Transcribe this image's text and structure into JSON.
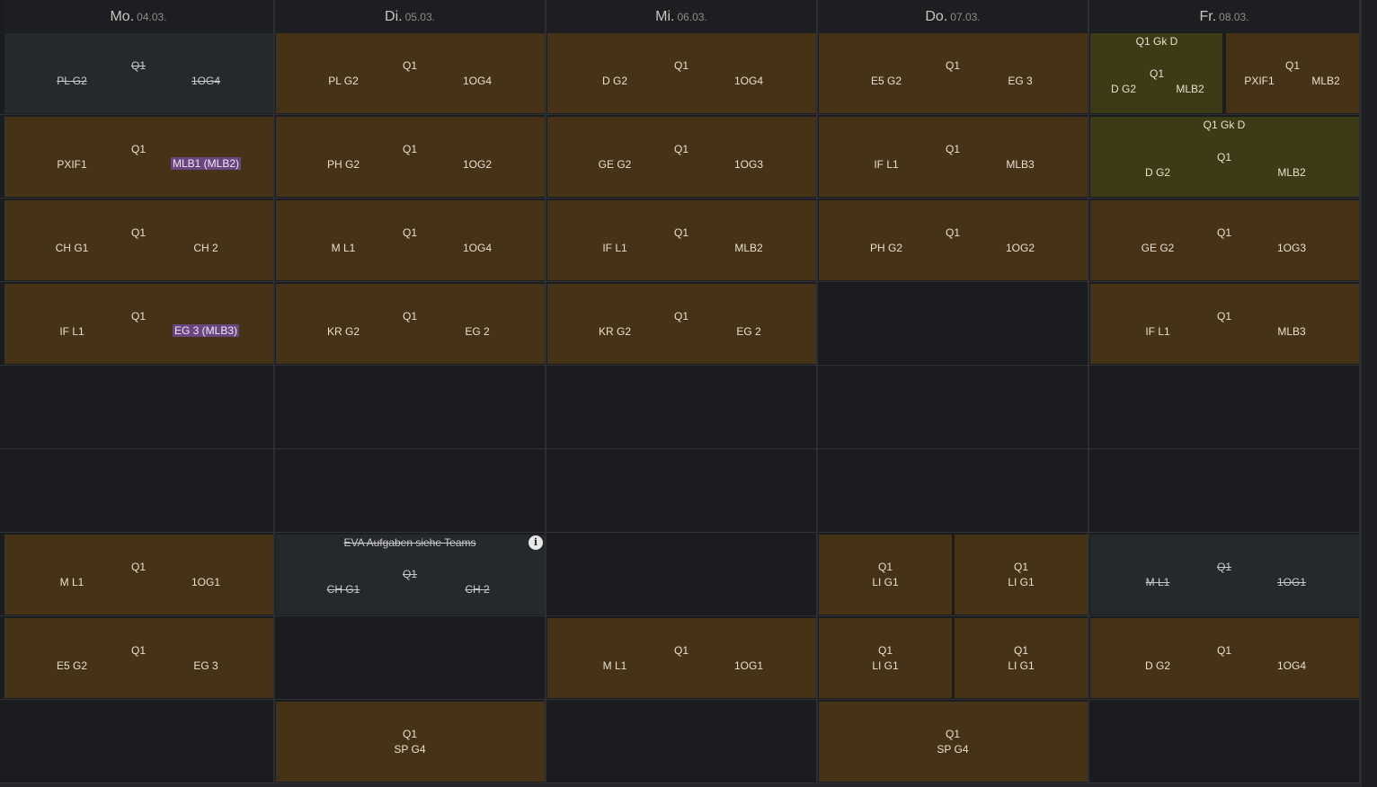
{
  "days": [
    {
      "name": "Mo.",
      "date": "04.03."
    },
    {
      "name": "Di.",
      "date": "05.03."
    },
    {
      "name": "Mi.",
      "date": "06.03."
    },
    {
      "name": "Do.",
      "date": "07.03."
    },
    {
      "name": "Fr.",
      "date": "08.03."
    }
  ],
  "cells": {
    "mo_1": {
      "group": "Q1",
      "subject": "PL G2",
      "room": "1OG4"
    },
    "di_1": {
      "group": "Q1",
      "subject": "PL G2",
      "room": "1OG4"
    },
    "mi_1": {
      "group": "Q1",
      "subject": "D G2",
      "room": "1OG4"
    },
    "do_1": {
      "group": "Q1",
      "subject": "E5 G2",
      "room": "EG 3"
    },
    "fr_1a": {
      "title": "Q1 Gk D",
      "group": "Q1",
      "subject": "D G2",
      "room": "MLB2"
    },
    "fr_1b": {
      "group": "Q1",
      "subject": "PXIF1",
      "room": "MLB2"
    },
    "mo_2": {
      "group": "Q1",
      "subject": "PXIF1",
      "room": "MLB1 (MLB2)"
    },
    "di_2": {
      "group": "Q1",
      "subject": "PH G2",
      "room": "1OG2"
    },
    "mi_2": {
      "group": "Q1",
      "subject": "GE G2",
      "room": "1OG3"
    },
    "do_2": {
      "group": "Q1",
      "subject": "IF L1",
      "room": "MLB3"
    },
    "fr_2": {
      "title": "Q1 Gk D",
      "group": "Q1",
      "subject": "D G2",
      "room": "MLB2"
    },
    "mo_3": {
      "group": "Q1",
      "subject": "CH G1",
      "room": "CH 2"
    },
    "di_3": {
      "group": "Q1",
      "subject": "M L1",
      "room": "1OG4"
    },
    "mi_3": {
      "group": "Q1",
      "subject": "IF L1",
      "room": "MLB2"
    },
    "do_3": {
      "group": "Q1",
      "subject": "PH G2",
      "room": "1OG2"
    },
    "fr_3": {
      "group": "Q1",
      "subject": "GE G2",
      "room": "1OG3"
    },
    "mo_4": {
      "group": "Q1",
      "subject": "IF L1",
      "room": "EG 3 (MLB3)"
    },
    "di_4": {
      "group": "Q1",
      "subject": "KR G2",
      "room": "EG 2"
    },
    "mi_4": {
      "group": "Q1",
      "subject": "KR G2",
      "room": "EG 2"
    },
    "fr_4": {
      "group": "Q1",
      "subject": "IF L1",
      "room": "MLB3"
    },
    "mo_7": {
      "group": "Q1",
      "subject": "M L1",
      "room": "1OG1"
    },
    "di_7": {
      "title": "EVA Aufgaben siehe Teams",
      "group": "Q1",
      "subject": "CH G1",
      "room": "CH 2"
    },
    "do_7a": {
      "group": "Q1",
      "subject": "LI G1"
    },
    "do_7b": {
      "group": "Q1",
      "subject": "LI G1"
    },
    "fr_7": {
      "group": "Q1",
      "subject": "M L1",
      "room": "1OG1"
    },
    "mo_8": {
      "group": "Q1",
      "subject": "E5 G2",
      "room": "EG 3"
    },
    "mi_8": {
      "group": "Q1",
      "subject": "M L1",
      "room": "1OG1"
    },
    "do_8a": {
      "group": "Q1",
      "subject": "LI G1"
    },
    "do_8b": {
      "group": "Q1",
      "subject": "LI G1"
    },
    "fr_8": {
      "group": "Q1",
      "subject": "D G2",
      "room": "1OG4"
    },
    "di_9": {
      "group": "Q1",
      "subject": "SP G4"
    },
    "do_9": {
      "group": "Q1",
      "subject": "SP G4"
    }
  },
  "icons": {
    "info": "info-icon"
  },
  "colors": {
    "lesson": "#463217",
    "cancelled": "#25282d",
    "exam": "#3c3b16",
    "highlight": "#6a4680",
    "background": "#1b1c1f"
  }
}
